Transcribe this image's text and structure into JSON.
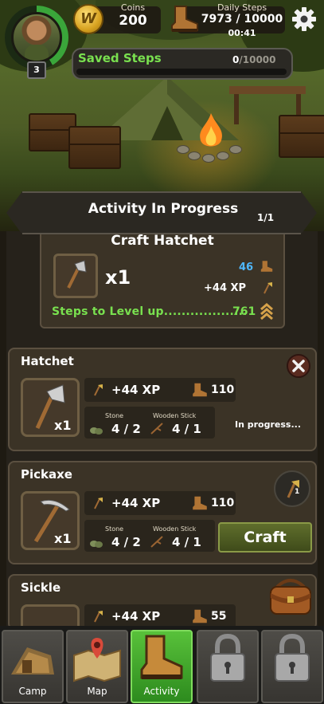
{
  "hud": {
    "level": "3",
    "coins_label": "Coins",
    "coins_value": "200",
    "coin_symbol": "W",
    "daily_steps_label": "Daily Steps",
    "daily_steps_value": "7973 / 10000",
    "timer": "00:41",
    "saved_steps_label": "Saved Steps",
    "saved_steps_current": "0",
    "saved_steps_max": "/10000",
    "saved_steps_progress": 0
  },
  "activity": {
    "header": "Activity In Progress",
    "count": "1/1",
    "item_name": "Craft Hatchet",
    "quantity": "x1",
    "steps": "46",
    "xp": "+44 XP",
    "level_up_text": "Steps to Level up...................",
    "level_up_value": "761"
  },
  "recipes": [
    {
      "name": "Hatchet",
      "quantity": "x1",
      "xp": "+44 XP",
      "steps": "110",
      "resources": [
        {
          "name": "Stone",
          "value": "4 / 2"
        },
        {
          "name": "Wooden Stick",
          "value": "4 / 1"
        }
      ],
      "status": "In progress..."
    },
    {
      "name": "Pickaxe",
      "quantity": "x1",
      "xp": "+44 XP",
      "steps": "110",
      "resources": [
        {
          "name": "Stone",
          "value": "4 / 2"
        },
        {
          "name": "Wooden Stick",
          "value": "4 / 1"
        }
      ],
      "action": "Craft",
      "required_level": "1"
    },
    {
      "name": "Sickle",
      "xp": "+44 XP",
      "steps": "55"
    }
  ],
  "nav": [
    {
      "label": "Camp",
      "icon": "camp-icon"
    },
    {
      "label": "Map",
      "icon": "map-icon"
    },
    {
      "label": "Activity",
      "icon": "boot-icon",
      "active": true
    },
    {
      "label": "",
      "icon": "lock-icon"
    },
    {
      "label": "",
      "icon": "lock-icon"
    }
  ],
  "colors": {
    "accent_green": "#79e04f",
    "steps_blue": "#4fb7ff",
    "active_tab": "#4cae31"
  }
}
